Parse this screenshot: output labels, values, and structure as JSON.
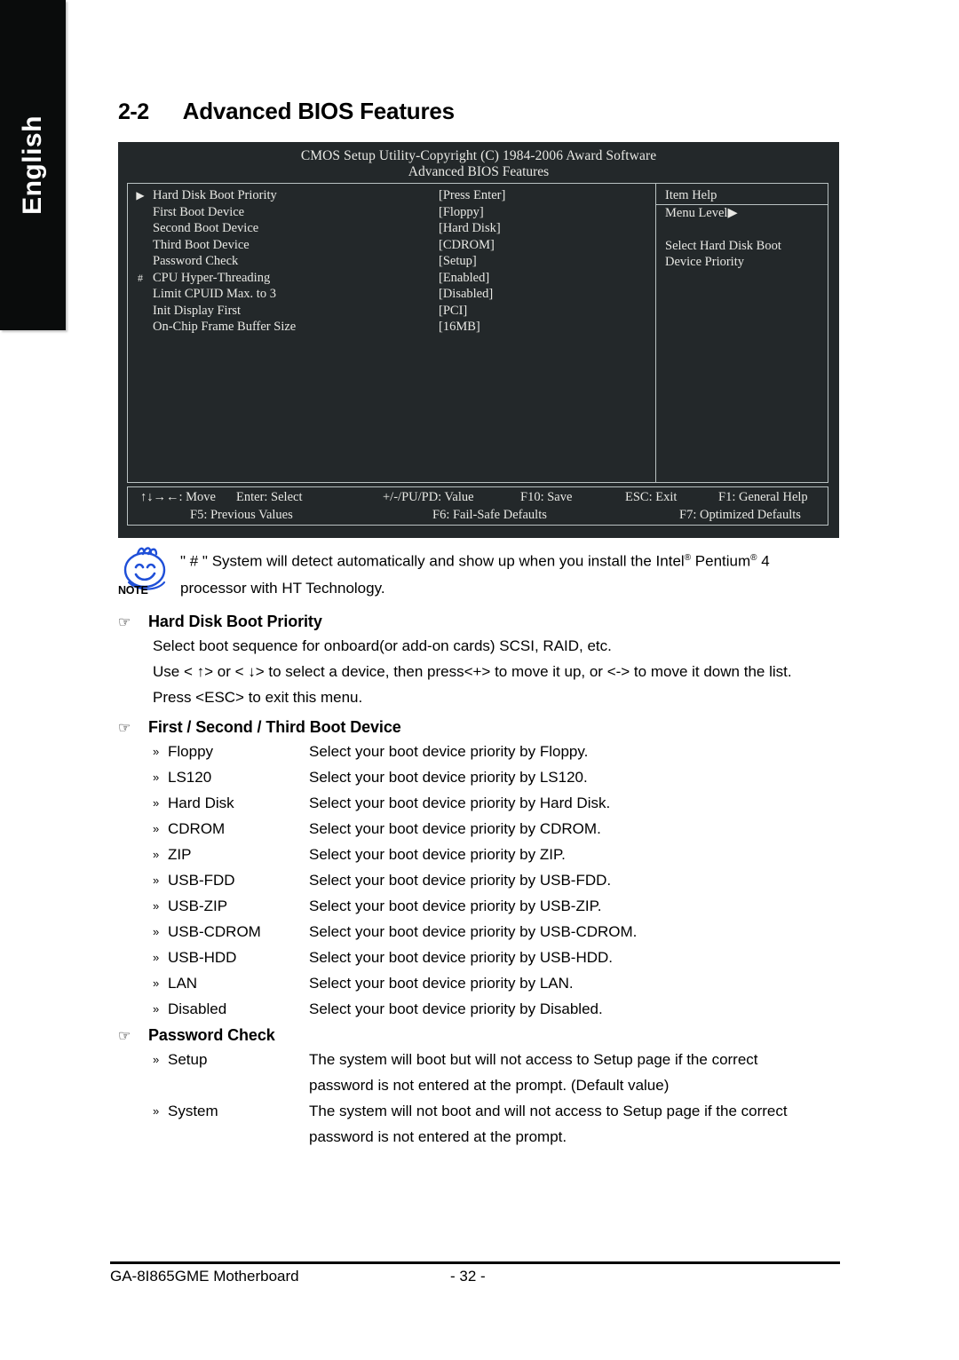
{
  "sidebar": {
    "language": "English"
  },
  "section": {
    "number": "2-2",
    "title": "Advanced BIOS Features"
  },
  "bios": {
    "title_line1": "CMOS Setup Utility-Copyright (C) 1984-2006 Award Software",
    "title_line2": "Advanced BIOS Features",
    "rows": [
      {
        "marker": "▶",
        "label": "Hard Disk Boot Priority",
        "value": "[Press Enter]"
      },
      {
        "marker": "",
        "label": "First Boot Device",
        "value": "[Floppy]"
      },
      {
        "marker": "",
        "label": "Second Boot Device",
        "value": "[Hard Disk]"
      },
      {
        "marker": "",
        "label": "Third Boot Device",
        "value": "[CDROM]"
      },
      {
        "marker": "",
        "label": "Password Check",
        "value": "[Setup]"
      },
      {
        "marker": "#",
        "label": "CPU Hyper-Threading",
        "value": "[Enabled]"
      },
      {
        "marker": "",
        "label": "Limit CPUID Max. to 3",
        "value": "[Disabled]"
      },
      {
        "marker": "",
        "label": "Init Display First",
        "value": "[PCI]"
      },
      {
        "marker": "",
        "label": "On-Chip Frame Buffer Size",
        "value": "[16MB]"
      }
    ],
    "help": {
      "title": "Item Help",
      "menu_level": "Menu Level▶",
      "lines": [
        "Select Hard Disk Boot",
        "Device Priority"
      ]
    },
    "footer": {
      "row1": [
        "↑↓→←: Move",
        "Enter: Select",
        "+/-/PU/PD: Value",
        "F10: Save",
        "ESC: Exit",
        "F1: General Help"
      ],
      "row2": [
        "F5: Previous Values",
        "F6: Fail-Safe Defaults",
        "F7: Optimized Defaults"
      ]
    }
  },
  "note": {
    "icon": "note-smiley-icon",
    "word": "NOTE",
    "line1_a": "\" # \" System will detect automatically and show up when you install the Intel",
    "line1_reg1": "®",
    "line1_b": " Pentium",
    "line1_reg2": "®",
    "line1_c": " 4",
    "line2": "processor with HT Technology."
  },
  "topics": [
    {
      "id": "hard-disk-boot-priority",
      "heading": "Hard Disk Boot Priority",
      "paragraphs": [
        "Select boot sequence for onboard(or add-on cards) SCSI, RAID, etc.",
        "Use < ↑> or < ↓> to select a device, then press<+> to move it up, or <-> to move it down the list.",
        "Press <ESC> to exit this menu."
      ]
    },
    {
      "id": "boot-device",
      "heading": "First / Second / Third Boot Device",
      "items": [
        {
          "term": "Floppy",
          "desc": "Select your boot device priority by Floppy."
        },
        {
          "term": "LS120",
          "desc": "Select your boot device priority by LS120."
        },
        {
          "term": "Hard Disk",
          "desc": "Select your boot device priority by Hard Disk."
        },
        {
          "term": "CDROM",
          "desc": "Select your boot device priority by CDROM."
        },
        {
          "term": "ZIP",
          "desc": "Select your boot device priority by ZIP."
        },
        {
          "term": "USB-FDD",
          "desc": "Select your boot device priority by USB-FDD."
        },
        {
          "term": "USB-ZIP",
          "desc": "Select your boot device priority by USB-ZIP."
        },
        {
          "term": "USB-CDROM",
          "desc": "Select your boot device priority by USB-CDROM."
        },
        {
          "term": "USB-HDD",
          "desc": "Select your boot device priority by USB-HDD."
        },
        {
          "term": "LAN",
          "desc": "Select your boot device priority by LAN."
        },
        {
          "term": "Disabled",
          "desc": "Select your boot device priority by Disabled."
        }
      ]
    },
    {
      "id": "password-check",
      "heading": "Password Check",
      "items": [
        {
          "term": "Setup",
          "desc": "The system will boot but will not access to Setup page if the correct",
          "desc2": "password is not entered at the prompt. (Default value)"
        },
        {
          "term": "System",
          "desc": "The system will not boot and will not access to Setup page if the correct",
          "desc2": "password is not entered at the prompt."
        }
      ]
    }
  ],
  "footer": {
    "left": "GA-8I865GME Motherboard",
    "center": "- 32 -"
  },
  "glyphs": {
    "hand": "☞",
    "chevron": "»"
  },
  "colors": {
    "bios_bg": "#23282a",
    "bios_border": "#b9c2c2",
    "tab_bg": "#0a0c0c",
    "note_blue": "#1f4fd8"
  }
}
